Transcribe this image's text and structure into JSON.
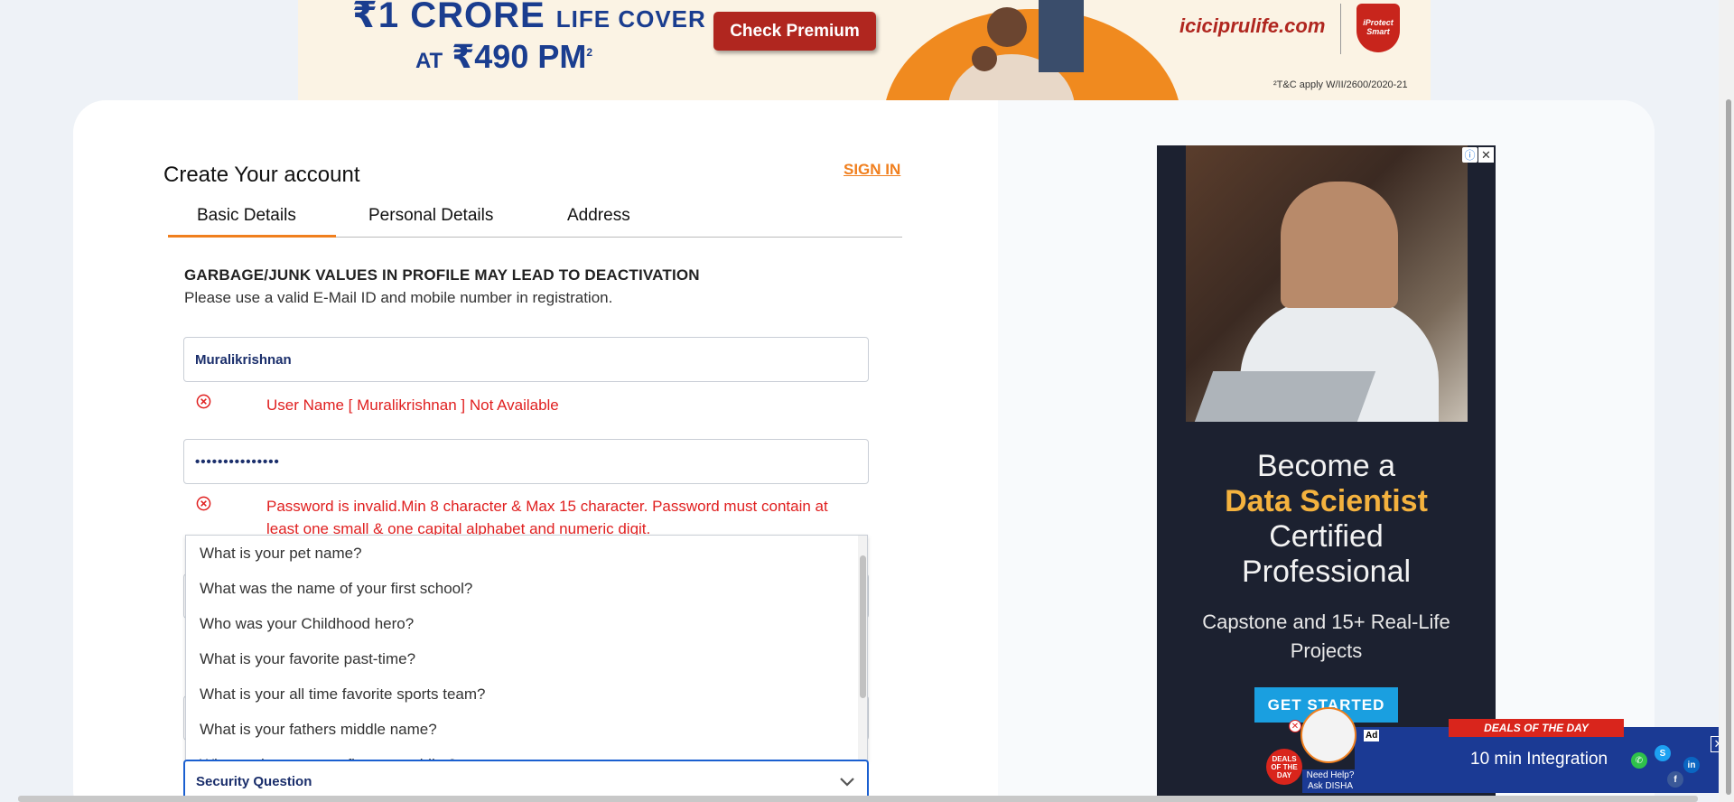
{
  "top_banner": {
    "line1_big": "₹1 CRORE",
    "line1_small": "LIFE COVER",
    "line2_small": "AT",
    "line2_big": "₹490 PM",
    "line2_sup": "2",
    "button": "Check Premium",
    "site": "iciciprulife.com",
    "shield": "iProtect Smart",
    "tc": "²T&C apply W/II/2600/2020-21"
  },
  "form": {
    "title": "Create Your account",
    "sign_in": "SIGN IN",
    "tabs": [
      {
        "label": "Basic Details",
        "active": true
      },
      {
        "label": "Personal Details",
        "active": false
      },
      {
        "label": "Address",
        "active": false
      }
    ],
    "warning_title": "GARBAGE/JUNK VALUES IN PROFILE MAY LEAD TO DEACTIVATION",
    "warning_sub": "Please use a valid E-Mail ID and mobile number in registration.",
    "username_value": "Muralikrishnan",
    "username_error": "User Name [ Muralikrishnan ] Not Available",
    "password_value": "•••••••••••••••",
    "password_error": "Password is invalid.Min 8 character & Max 15 character. Password must contain at least one small & one capital alphabet and numeric digit.",
    "security_question": {
      "selected": "Security Question",
      "options": [
        "What is your pet name?",
        "What was the name of your first school?",
        "Who was your Childhood hero?",
        "What is your favorite past-time?",
        "What is your all time favorite sports team?",
        "What is your fathers middle name?",
        "What make was your first car or bike?"
      ]
    }
  },
  "right_ad": {
    "line1": "Become a",
    "line2": "Data Scientist",
    "line3": "Certified",
    "line4": "Professional",
    "sub1": "Capstone and 15+ Real-Life",
    "sub2": "Projects",
    "button": "GET STARTED"
  },
  "deals": {
    "ribbon": "DEALS OF THE DAY",
    "ad_label": "Ad",
    "text": "10 min Integration",
    "badge": "DEALS OF THE DAY",
    "disha": "Need Help? Ask DISHA"
  },
  "colors": {
    "accent": "#f07f1e",
    "error": "#e02020",
    "ad_bg": "#1c2130",
    "ad_accent": "#f4b23e",
    "cta_blue": "#1a9fe0"
  }
}
